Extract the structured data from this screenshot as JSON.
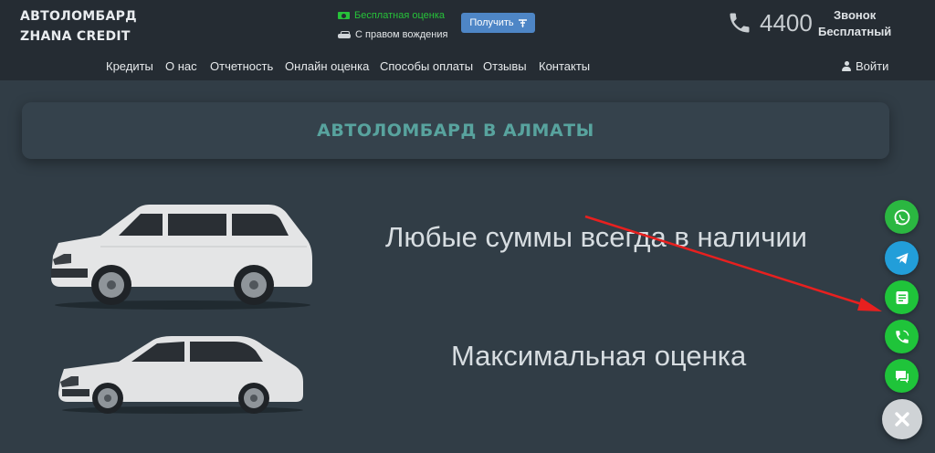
{
  "brand": {
    "line1": "АВТОЛОМБАРД",
    "line2": "ZHANA CREDIT"
  },
  "promo": {
    "free_eval": "Бесплатная оценка",
    "with_driving": "С правом вождения",
    "get_button": "Получить"
  },
  "contact": {
    "phone": "4400",
    "call_line1": "Звонок",
    "call_line2": "Бесплатный"
  },
  "nav": {
    "items": [
      "Кредиты",
      "О нас",
      "Отчетность",
      "Онлайн оценка",
      "Способы оплаты",
      "Отзывы",
      "Контакты"
    ],
    "login": "Войти"
  },
  "hero": {
    "title": "АВТОЛОМБАРД В АЛМАТЫ",
    "tagline1": "Любые суммы всегда в наличии",
    "tagline2": "Максимальная оценка"
  },
  "floating": [
    {
      "icon": "whatsapp-icon",
      "color": "#2bb741"
    },
    {
      "icon": "telegram-icon",
      "color": "#229ed9"
    },
    {
      "icon": "form-icon",
      "color": "#1fc43a"
    },
    {
      "icon": "viber-icon",
      "color": "#1fc43a"
    },
    {
      "icon": "chat-icon",
      "color": "#1fc43a"
    }
  ],
  "colors": {
    "accent": "#58a39e",
    "header_bg": "#252c33",
    "page_bg": "#313d46",
    "arrow": "#e8201f",
    "button": "#4e86c6"
  }
}
